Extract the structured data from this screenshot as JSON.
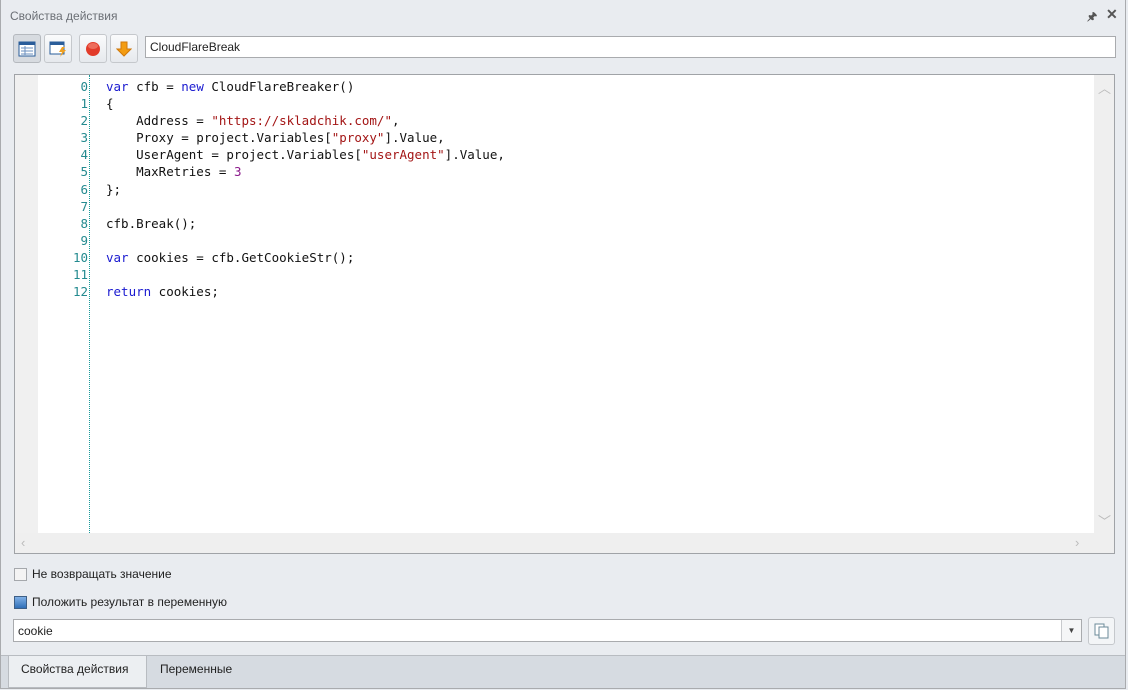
{
  "panel": {
    "title": "Свойства действия"
  },
  "toolbar": {
    "action_name": "CloudFlareBreak"
  },
  "editor": {
    "line_numbers": [
      "0",
      "1",
      "2",
      "3",
      "4",
      "5",
      "6",
      "7",
      "8",
      "9",
      "10",
      "11",
      "12"
    ],
    "lines": [
      [
        {
          "t": "var",
          "c": "kw"
        },
        {
          "t": " cfb = "
        },
        {
          "t": "new",
          "c": "kw"
        },
        {
          "t": " CloudFlareBreaker()"
        }
      ],
      [
        {
          "t": "{"
        }
      ],
      [
        {
          "t": "    Address = "
        },
        {
          "t": "\"https://skladchik.com/\"",
          "c": "str"
        },
        {
          "t": ","
        }
      ],
      [
        {
          "t": "    Proxy = project.Variables["
        },
        {
          "t": "\"proxy\"",
          "c": "str"
        },
        {
          "t": "].Value,"
        }
      ],
      [
        {
          "t": "    UserAgent = project.Variables["
        },
        {
          "t": "\"userAgent\"",
          "c": "str"
        },
        {
          "t": "].Value,"
        }
      ],
      [
        {
          "t": "    MaxRetries = "
        },
        {
          "t": "3",
          "c": "num"
        }
      ],
      [
        {
          "t": "};"
        }
      ],
      [
        {
          "t": ""
        }
      ],
      [
        {
          "t": "cfb.Break();"
        }
      ],
      [
        {
          "t": ""
        }
      ],
      [
        {
          "t": "var",
          "c": "kw"
        },
        {
          "t": " cookies = cfb.GetCookieStr();"
        }
      ],
      [
        {
          "t": ""
        }
      ],
      [
        {
          "t": "return",
          "c": "kw"
        },
        {
          "t": " cookies;"
        }
      ]
    ]
  },
  "options": {
    "no_return_label": "Не возвращать значение",
    "no_return_checked": false,
    "save_to_var_label": "Положить результат в переменную",
    "save_to_var_checked": true,
    "variable_value": "cookie"
  },
  "tabs": [
    {
      "label": "Свойства действия",
      "selected": true
    },
    {
      "label": "Переменные",
      "selected": false
    }
  ]
}
